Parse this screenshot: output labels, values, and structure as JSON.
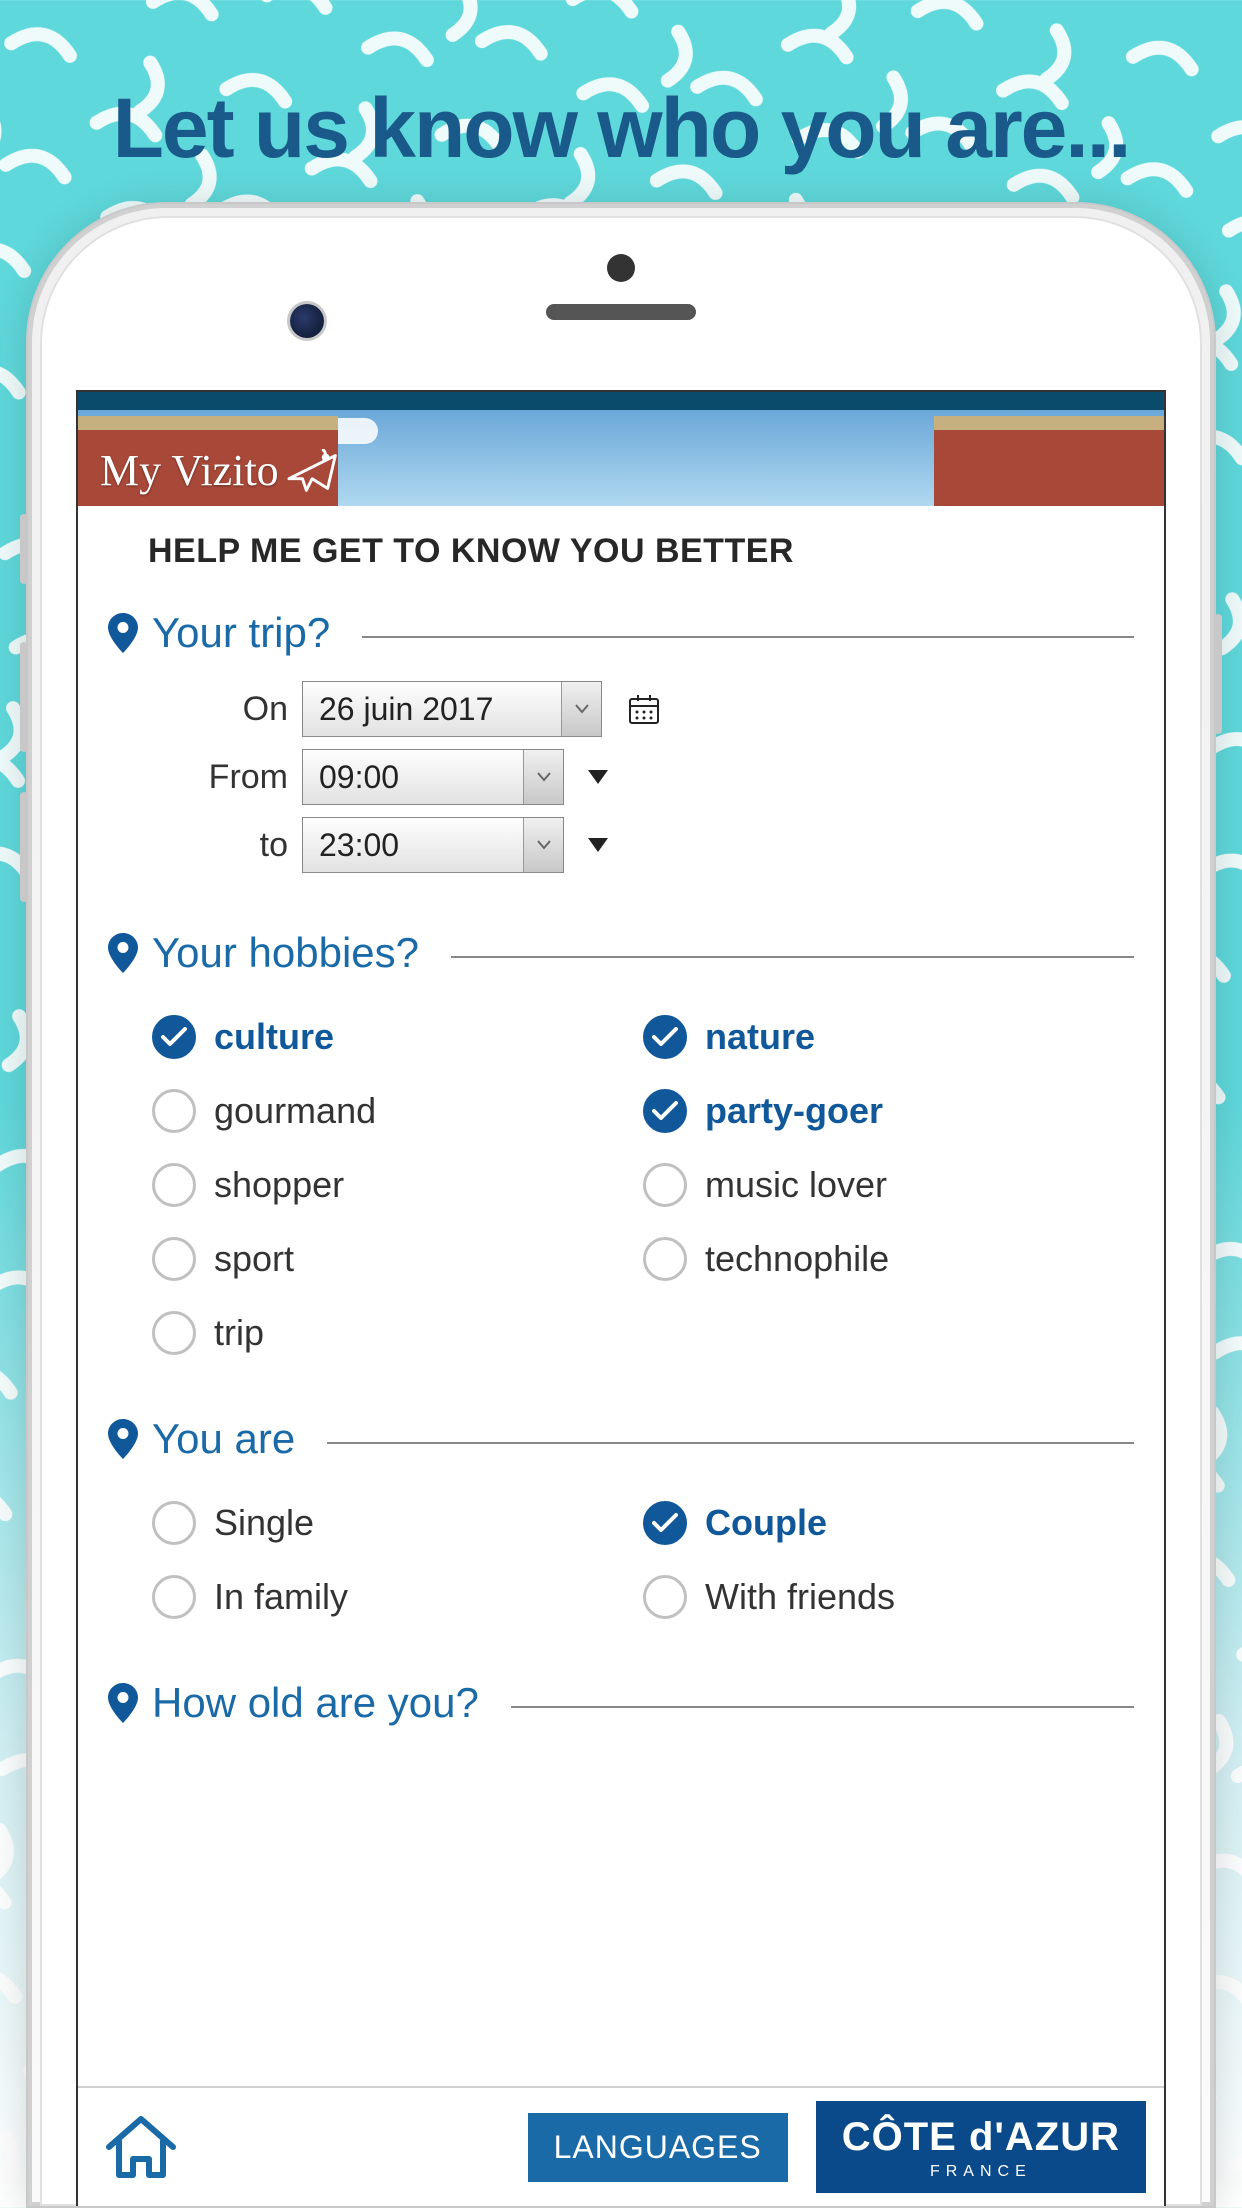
{
  "headline": "Let us know who you are...",
  "hero": {
    "logo_text": "My Vizito"
  },
  "subhead": "HELP ME GET TO KNOW YOU BETTER",
  "sections": {
    "trip": {
      "title": "Your trip?",
      "on_label": "On",
      "on_value": "26 juin 2017",
      "from_label": "From",
      "from_value": "09:00",
      "to_label": "to",
      "to_value": "23:00"
    },
    "hobbies": {
      "title": "Your hobbies?",
      "items": [
        {
          "label": "culture",
          "checked": true
        },
        {
          "label": "nature",
          "checked": true
        },
        {
          "label": "gourmand",
          "checked": false
        },
        {
          "label": "party-goer",
          "checked": true
        },
        {
          "label": "shopper",
          "checked": false
        },
        {
          "label": "music lover",
          "checked": false
        },
        {
          "label": "sport",
          "checked": false
        },
        {
          "label": "technophile",
          "checked": false
        },
        {
          "label": "trip",
          "checked": false
        }
      ]
    },
    "you_are": {
      "title": "You are",
      "items": [
        {
          "label": "Single",
          "checked": false
        },
        {
          "label": "Couple",
          "checked": true
        },
        {
          "label": "In family",
          "checked": false
        },
        {
          "label": "With friends",
          "checked": false
        }
      ]
    },
    "age": {
      "title": "How old are you?"
    }
  },
  "bottombar": {
    "languages_label": "LANGUAGES",
    "brand_top": "CÔTE d'AZUR",
    "brand_sub": "FRANCE"
  }
}
